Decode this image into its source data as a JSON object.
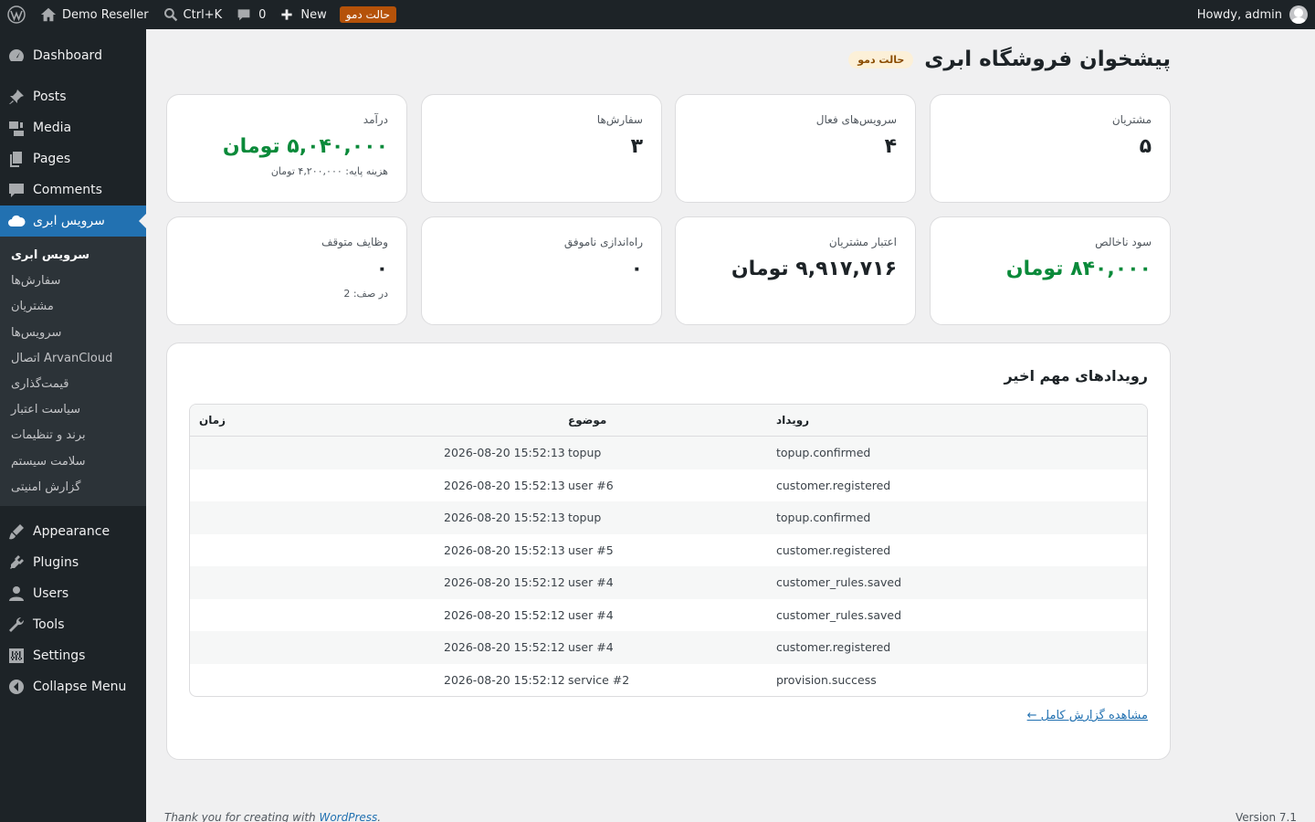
{
  "adminbar": {
    "site_name": "Demo Reseller",
    "search_shortcut": "Ctrl+K",
    "comments_count": "0",
    "new_label": "New",
    "demo_badge": "حالت دمو",
    "howdy": "Howdy, admin"
  },
  "sidebar": {
    "dashboard": "Dashboard",
    "posts": "Posts",
    "media": "Media",
    "pages": "Pages",
    "comments": "Comments",
    "cloud_service": "سرویس ابری",
    "submenu": [
      "سرویس ابری",
      "سفارش‌ها",
      "مشتریان",
      "سرویس‌ها",
      "اتصال ArvanCloud",
      "قیمت‌گذاری",
      "سیاست اعتبار",
      "برند و تنظیمات",
      "سلامت سیستم",
      "گزارش امنیتی"
    ],
    "appearance": "Appearance",
    "plugins": "Plugins",
    "users": "Users",
    "tools": "Tools",
    "settings": "Settings",
    "collapse": "Collapse Menu"
  },
  "page": {
    "title": "پیشخوان فروشگاه ابری",
    "demo_pill": "حالت دمو"
  },
  "stats": {
    "customers": {
      "label": "مشتریان",
      "value": "۵"
    },
    "active_services": {
      "label": "سرویس‌های فعال",
      "value": "۴"
    },
    "orders": {
      "label": "سفارش‌ها",
      "value": "۳"
    },
    "revenue": {
      "label": "درآمد",
      "value": "۵,۰۴۰,۰۰۰ تومان",
      "sub": "هزینه پایه: ۴,۲۰۰,۰۰۰ تومان"
    },
    "net_profit": {
      "label": "سود ناخالص",
      "value": "۸۴۰,۰۰۰ تومان"
    },
    "customer_credit": {
      "label": "اعتبار مشتریان",
      "value": "۹,۹۱۷,۷۱۶ تومان"
    },
    "failed_provision": {
      "label": "راه‌اندازی ناموفق",
      "value": "۰"
    },
    "stuck_jobs": {
      "label": "وظایف متوقف",
      "value": "۰",
      "sub": "در صف: 2"
    }
  },
  "events": {
    "title": "رویدادهای مهم اخیر",
    "headers": {
      "event": "رویداد",
      "subject": "موضوع",
      "time": "زمان"
    },
    "rows": [
      {
        "event": "topup.confirmed",
        "subject": "topup",
        "time": "2026-08-20 15:52:13"
      },
      {
        "event": "customer.registered",
        "subject": "user #6",
        "time": "2026-08-20 15:52:13"
      },
      {
        "event": "topup.confirmed",
        "subject": "topup",
        "time": "2026-08-20 15:52:13"
      },
      {
        "event": "customer.registered",
        "subject": "user #5",
        "time": "2026-08-20 15:52:13"
      },
      {
        "event": "customer_rules.saved",
        "subject": "user #4",
        "time": "2026-08-20 15:52:12"
      },
      {
        "event": "customer_rules.saved",
        "subject": "user #4",
        "time": "2026-08-20 15:52:12"
      },
      {
        "event": "customer.registered",
        "subject": "user #4",
        "time": "2026-08-20 15:52:12"
      },
      {
        "event": "provision.success",
        "subject": "service #2",
        "time": "2026-08-20 15:52:12"
      }
    ],
    "report_link": "مشاهده گزارش کامل ←"
  },
  "footer": {
    "thanks_prefix": "Thank you for creating with",
    "wordpress": "WordPress",
    "version": "Version 7.1"
  },
  "colors": {
    "accent": "#2271b1",
    "green": "#0a8a3a",
    "bar_bg": "#1d2327",
    "badge": "#b55209"
  }
}
